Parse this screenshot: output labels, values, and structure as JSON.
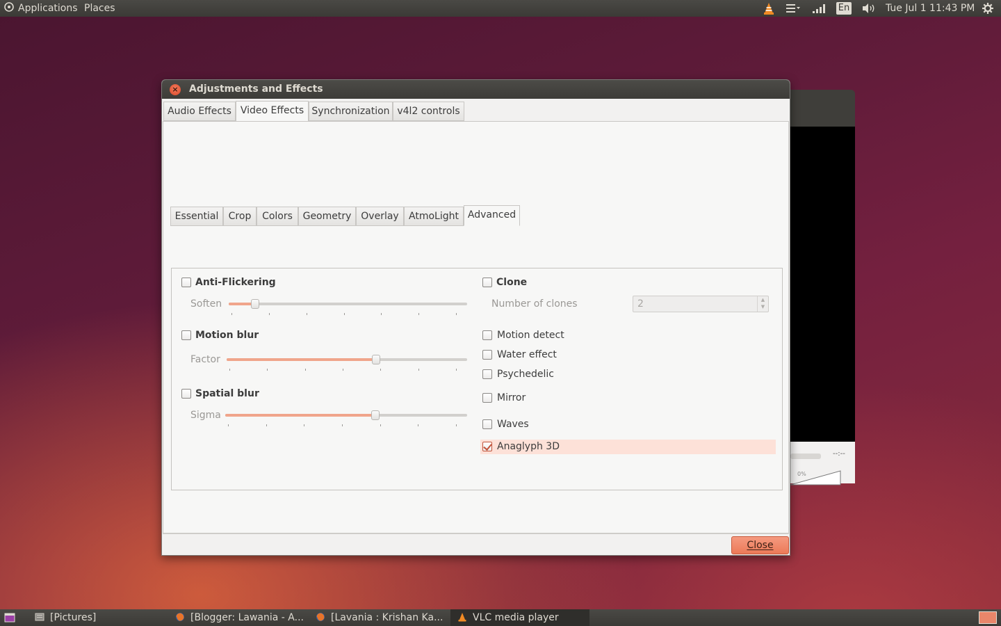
{
  "top_panel": {
    "applications": "Applications",
    "places": "Places",
    "keyboard": "En",
    "clock": "Tue Jul  1 11:43 PM"
  },
  "dialog": {
    "title": "Adjustments and Effects",
    "main_tabs": [
      "Audio Effects",
      "Video Effects",
      "Synchronization",
      "v4l2 controls"
    ],
    "active_main_tab": "Video Effects",
    "sub_tabs": [
      "Essential",
      "Crop",
      "Colors",
      "Geometry",
      "Overlay",
      "AtmoLight",
      "Advanced"
    ],
    "active_sub_tab": "Advanced",
    "left": {
      "anti_flickering": {
        "label": "Anti-Flickering",
        "checked": false,
        "slider_label": "Soften",
        "value_fraction": 0.11
      },
      "motion_blur": {
        "label": "Motion blur",
        "checked": false,
        "slider_label": "Factor",
        "value_fraction": 0.62
      },
      "spatial_blur": {
        "label": "Spatial blur",
        "checked": false,
        "slider_label": "Sigma",
        "value_fraction": 0.62
      }
    },
    "right": {
      "clone": {
        "label": "Clone",
        "checked": false,
        "clones_label": "Number of clones",
        "clones_value": "2"
      },
      "motion_detect": {
        "label": "Motion detect",
        "checked": false
      },
      "water_effect": {
        "label": "Water effect",
        "checked": false
      },
      "psychedelic": {
        "label": "Psychedelic",
        "checked": false
      },
      "mirror": {
        "label": "Mirror",
        "checked": false
      },
      "waves": {
        "label": "Waves",
        "checked": false
      },
      "anaglyph_3d": {
        "label": "Anaglyph 3D",
        "checked": true
      }
    },
    "close_label": "Close"
  },
  "vlc_background": {
    "time": "--:--",
    "volume": "0%"
  },
  "taskbar": {
    "tasks": [
      "[Pictures]",
      "[Blogger: Lawania - A...",
      "[Lavania : Krishan Ka...",
      "VLC media player"
    ]
  },
  "colors": {
    "accent": "#ec7a58",
    "highlight": "#fde1d8"
  }
}
